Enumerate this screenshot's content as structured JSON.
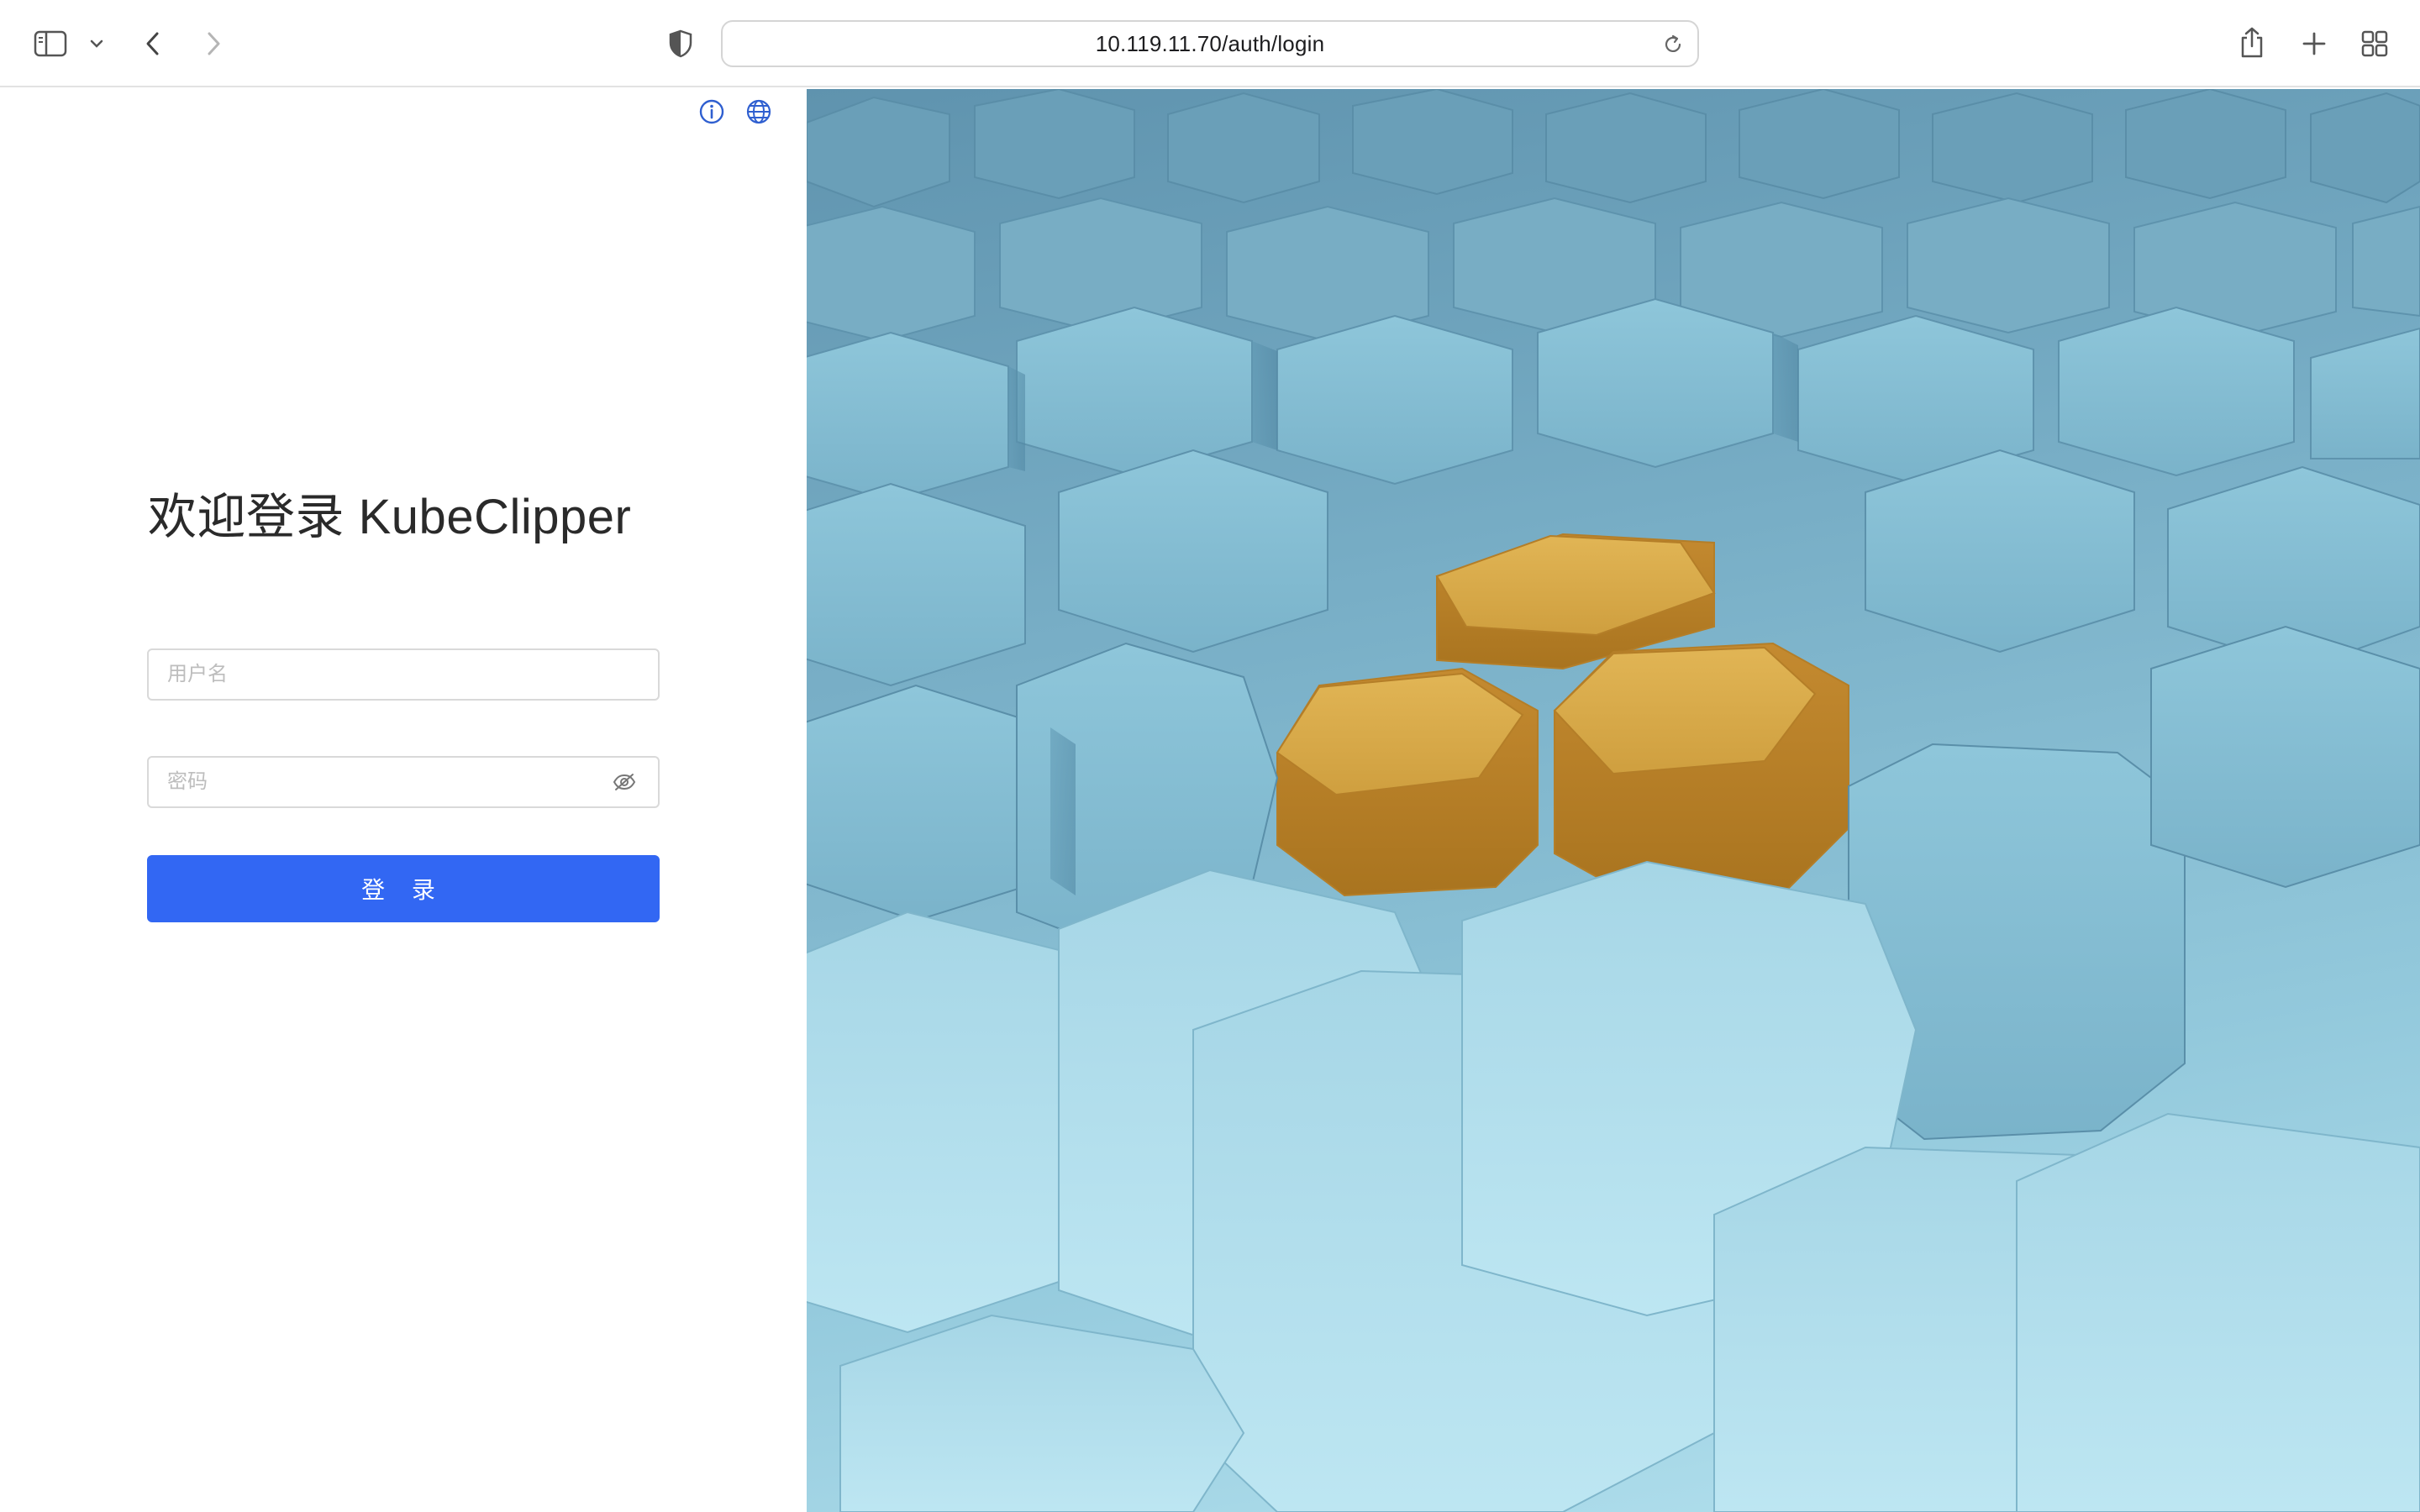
{
  "browser": {
    "url": "10.119.11.70/auth/login"
  },
  "login": {
    "title": "欢迎登录 KubeClipper",
    "username_placeholder": "用户名",
    "password_placeholder": "密码",
    "submit_label": "登 录"
  },
  "colors": {
    "primary": "#3267f3",
    "icon_blue": "#2f5fd0",
    "hex_blue": "#7db4cb",
    "hex_gold": "#d7ad50"
  }
}
